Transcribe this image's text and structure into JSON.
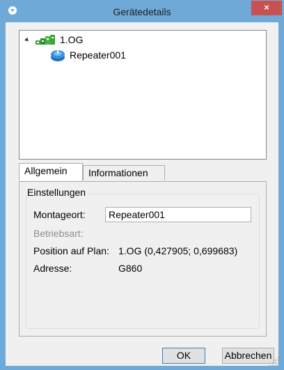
{
  "window": {
    "title": "Gerätedetails",
    "close_glyph": "×"
  },
  "tree": {
    "items": [
      {
        "label": "1.OG",
        "icon": "floor-plan-icon"
      },
      {
        "label": "Repeater001",
        "icon": "repeater-icon"
      }
    ]
  },
  "tabs": [
    {
      "label": "Allgemein",
      "active": true
    },
    {
      "label": "Informationen",
      "active": false
    }
  ],
  "settings": {
    "group_title": "Einstellungen",
    "montageort_label": "Montageort:",
    "montageort_value": "Repeater001",
    "betriebsart_label": "Betriebsart:",
    "position_label": "Position auf Plan:",
    "position_value": "1.OG (0,427905; 0,699683)",
    "adresse_label": "Adresse:",
    "adresse_value": "G860"
  },
  "buttons": {
    "ok": "OK",
    "cancel": "Abbrechen"
  },
  "colors": {
    "titlebar": "#6fa9d8",
    "close": "#c75050",
    "client": "#f0f0f0"
  }
}
